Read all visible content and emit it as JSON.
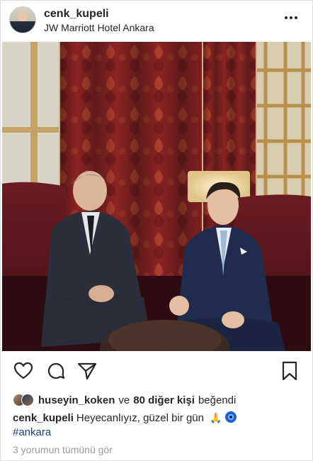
{
  "post": {
    "username": "cenk_kupeli",
    "location": "JW Marriott Hotel Ankara"
  },
  "likes": {
    "liker": "huseyin_koken",
    "connector": "ve",
    "count_text": "80 diğer kişi",
    "tail": "beğendi"
  },
  "caption": {
    "username": "cenk_kupeli",
    "text": "Heyecanlıyız, güzel bir gün",
    "emoji_pray": "🙏",
    "hashtag": "#ankara"
  },
  "comments_link": "3 yorumun tümünü gör",
  "icons": [
    "more-options-icon",
    "heart-icon",
    "comment-icon",
    "share-icon",
    "bookmark-icon"
  ],
  "colors": {
    "text": "#262626",
    "link": "#1d3f7a",
    "muted": "#9b9b9b",
    "curtain": "#8e2a2a"
  }
}
